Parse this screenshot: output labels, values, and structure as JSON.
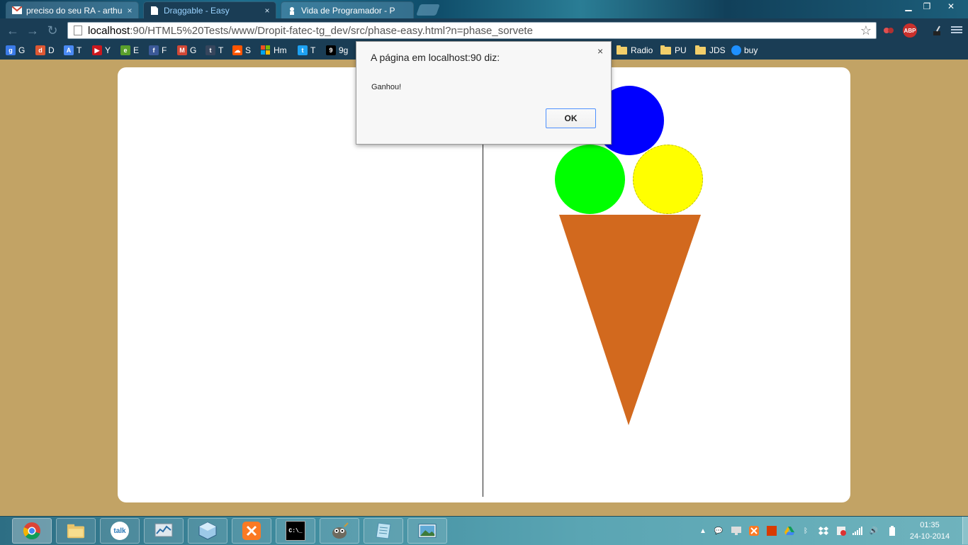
{
  "browser": {
    "tabs": [
      {
        "label": "preciso do seu RA - arthu",
        "icon": "gmail-icon",
        "active": false
      },
      {
        "label": "Draggable - Easy",
        "icon": "page-icon",
        "active": true
      },
      {
        "label": "Vida de Programador - P",
        "icon": "site-icon",
        "active": false
      }
    ],
    "url_host": "localhost",
    "url_path": ":90/HTML5%20Tests/www/Dropit-fatec-tg_dev/src/phase-easy.html?n=phase_sorvete",
    "window_controls": {
      "minimize": "▁",
      "restore": "❐",
      "close": "✕"
    }
  },
  "bookmarks": [
    {
      "label": "G",
      "icon": "google-icon",
      "color": "#3b7be8"
    },
    {
      "label": "D",
      "icon": "duckduckgo-icon",
      "color": "#de5833"
    },
    {
      "label": "T",
      "icon": "translate-icon",
      "color": "#4a8af4"
    },
    {
      "label": "Y",
      "icon": "youtube-icon",
      "color": "#cc181e"
    },
    {
      "label": "E",
      "icon": "evernote-icon",
      "color": "#5aa02c"
    },
    {
      "label": "F",
      "icon": "facebook-icon",
      "color": "#3b5998"
    },
    {
      "label": "G",
      "icon": "gmail-icon",
      "color": "#d14836"
    },
    {
      "label": "T",
      "icon": "tumblr-icon",
      "color": "#36465d"
    },
    {
      "label": "S",
      "icon": "soundcloud-icon",
      "color": "#ff5500"
    },
    {
      "label": "Hm",
      "icon": "windows-icon",
      "color": "#f25022"
    },
    {
      "label": "T",
      "icon": "twitter-icon",
      "color": "#1da1f2"
    },
    {
      "label": "9g",
      "icon": "9gag-icon",
      "color": "#000000"
    },
    {
      "label": "Radio",
      "icon": "folder-icon"
    },
    {
      "label": "PU",
      "icon": "folder-icon"
    },
    {
      "label": "JDS",
      "icon": "folder-icon"
    },
    {
      "label": "buy",
      "icon": "globe-icon",
      "color": "#1e90ff"
    }
  ],
  "extensions": {
    "abp": "ABP"
  },
  "game": {
    "scoops": [
      {
        "name": "blue-scoop",
        "color": "#0000ff"
      },
      {
        "name": "green-scoop",
        "color": "#00ff00"
      },
      {
        "name": "yellow-scoop",
        "color": "#ffff00"
      }
    ],
    "cone_color": "#d2691e",
    "background_color": "#c2a365"
  },
  "dialog": {
    "title": "A página em localhost:90 diz:",
    "close": "×",
    "message": "Ganhou!",
    "ok_label": "OK"
  },
  "taskbar": {
    "apps": [
      {
        "name": "chrome",
        "label": ""
      },
      {
        "name": "file-explorer",
        "label": ""
      },
      {
        "name": "google-talk",
        "label": "talk"
      },
      {
        "name": "performance-monitor",
        "label": ""
      },
      {
        "name": "virtualbox",
        "label": ""
      },
      {
        "name": "xampp",
        "label": ""
      },
      {
        "name": "command-prompt",
        "label": "C:\\_"
      },
      {
        "name": "gimp",
        "label": ""
      },
      {
        "name": "notepad",
        "label": ""
      },
      {
        "name": "photo-viewer",
        "label": ""
      }
    ],
    "time": "01:35",
    "date": "24-10-2014"
  }
}
